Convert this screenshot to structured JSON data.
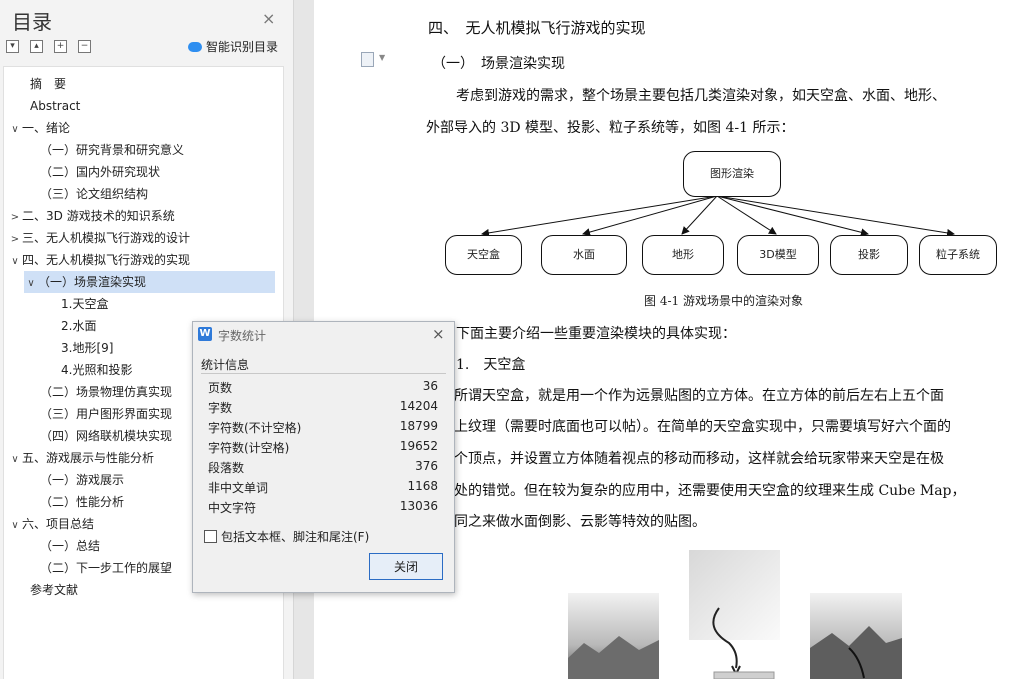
{
  "toc": {
    "title": "目录",
    "close_glyph": "×",
    "toolbar": {
      "collapse_glyph": "▾",
      "expand_glyph": "▴",
      "add_glyph": "+",
      "remove_glyph": "−"
    },
    "smart_label": "智能识别目录",
    "items": [
      {
        "label": "摘　要",
        "chev": ""
      },
      {
        "label": "Abstract",
        "chev": ""
      },
      {
        "label": "一、绪论",
        "chev": "∨"
      },
      {
        "label": "（一）研究背景和研究意义",
        "chev": ""
      },
      {
        "label": "（二）国内外研究现状",
        "chev": ""
      },
      {
        "label": "（三）论文组织结构",
        "chev": ""
      },
      {
        "label": "二、3D 游戏技术的知识系统",
        "chev": ">"
      },
      {
        "label": "三、无人机模拟飞行游戏的设计",
        "chev": ">"
      },
      {
        "label": "四、无人机模拟飞行游戏的实现",
        "chev": "∨"
      },
      {
        "label": "（一）场景渲染实现",
        "chev": "∨"
      },
      {
        "label": "1.天空盒",
        "chev": ""
      },
      {
        "label": "2.水面",
        "chev": ""
      },
      {
        "label": "3.地形[9]",
        "chev": ""
      },
      {
        "label": "4.光照和投影",
        "chev": ""
      },
      {
        "label": "（二）场景物理仿真实现",
        "chev": ""
      },
      {
        "label": "（三）用户图形界面实现",
        "chev": ""
      },
      {
        "label": "（四）网络联机模块实现",
        "chev": ""
      },
      {
        "label": "五、游戏展示与性能分析",
        "chev": "∨"
      },
      {
        "label": "（一）游戏展示",
        "chev": ""
      },
      {
        "label": "（二）性能分析",
        "chev": ""
      },
      {
        "label": "六、项目总结",
        "chev": "∨"
      },
      {
        "label": "（一）总结",
        "chev": ""
      },
      {
        "label": "（二）下一步工作的展望",
        "chev": ""
      },
      {
        "label": "参考文献",
        "chev": ""
      }
    ]
  },
  "doc": {
    "heading": "四、　无人机模拟飞行游戏的实现",
    "subheading": "（一）　场景渲染实现",
    "para1_line1": "考虑到游戏的需求，整个场景主要包括几类渲染对象，如天空盒、水面、地形、",
    "para1_line2": "外部导入的 3D 模型、投影、粒子系统等，如图 4-1 所示：",
    "diagram": {
      "root": "图形渲染",
      "children": [
        "天空盒",
        "水面",
        "地形",
        "3D模型",
        "投影",
        "粒子系统"
      ]
    },
    "figure_caption": "图 4-1  游戏场景中的渲染对象",
    "intro": "下面主要介绍一些重要渲染模块的具体实现：",
    "subsection": "1.　天空盒",
    "lines": [
      "所谓天空盒，就是用一个作为远景贴图的立方体。在立方体的前后左右上五个面",
      "上纹理（需要时底面也可以帖）。在简单的天空盒实现中，只需要填写好六个面的",
      "个顶点，并设置立方体随着视点的移动而移动，这样就会给玩家带来天空是在极",
      "处的错觉。但在较为复杂的应用中，还需要使用天空盒的纹理来生成 Cube Map，",
      "同之来做水面倒影、云影等特效的贴图。"
    ]
  },
  "dialog": {
    "icon_letter": "W",
    "title": "字数统计",
    "close_glyph": "×",
    "section": "统计信息",
    "stats": [
      {
        "label": "页数",
        "value": "36"
      },
      {
        "label": "字数",
        "value": "14204"
      },
      {
        "label": "字符数(不计空格)",
        "value": "18799"
      },
      {
        "label": "字符数(计空格)",
        "value": "19652"
      },
      {
        "label": "段落数",
        "value": "376"
      },
      {
        "label": "非中文单词",
        "value": "1168"
      },
      {
        "label": "中文字符",
        "value": "13036"
      }
    ],
    "checkbox_label": "包括文本框、脚注和尾注(F)",
    "checkbox_checked": false,
    "close_button": "关闭"
  }
}
